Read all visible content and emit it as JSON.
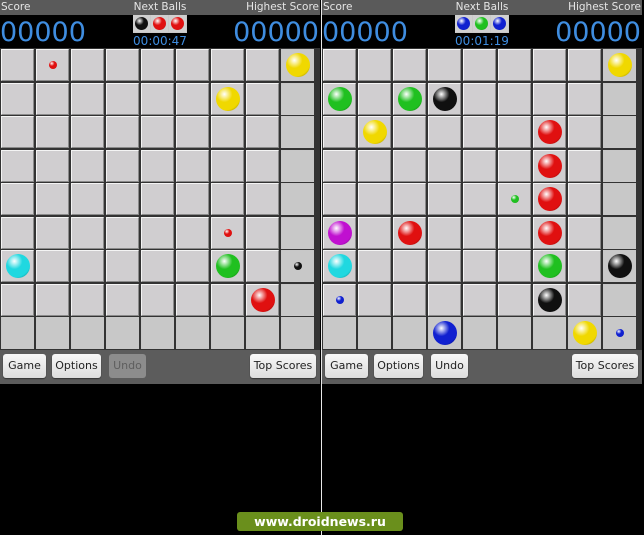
{
  "colors": {
    "red": "#e01010",
    "yellow": "#f0d800",
    "green": "#20c020",
    "black": "#101010",
    "cyan": "#20d8e0",
    "blue": "#1020d0",
    "magenta": "#c010d0",
    "score_text": "#3f8de0"
  },
  "screens": [
    {
      "header": {
        "score_label": "Score",
        "next_label": "Next Balls",
        "highest_label": "Highest Score"
      },
      "score": "00000",
      "highest_score": "00000",
      "next_balls": [
        "black",
        "red",
        "red"
      ],
      "timer": "00:00:47",
      "board": {
        "rows": 9,
        "cols": 9,
        "balls": [
          {
            "row": 0,
            "col": 1,
            "color": "red",
            "size": "small"
          },
          {
            "row": 0,
            "col": 8,
            "color": "yellow",
            "size": "big"
          },
          {
            "row": 1,
            "col": 6,
            "color": "yellow",
            "size": "big"
          },
          {
            "row": 5,
            "col": 6,
            "color": "red",
            "size": "small"
          },
          {
            "row": 6,
            "col": 0,
            "color": "cyan",
            "size": "big"
          },
          {
            "row": 6,
            "col": 6,
            "color": "green",
            "size": "big"
          },
          {
            "row": 6,
            "col": 8,
            "color": "black",
            "size": "small"
          },
          {
            "row": 7,
            "col": 7,
            "color": "red",
            "size": "big"
          }
        ]
      },
      "buttons": {
        "game": "Game",
        "options": "Options",
        "undo": "Undo",
        "undo_enabled": false,
        "top_scores": "Top Scores"
      }
    },
    {
      "header": {
        "score_label": "Score",
        "next_label": "Next Balls",
        "highest_label": "Highest Score"
      },
      "score": "00000",
      "highest_score": "00000",
      "next_balls": [
        "blue",
        "green",
        "blue"
      ],
      "timer": "00:01:19",
      "board": {
        "rows": 9,
        "cols": 9,
        "balls": [
          {
            "row": 0,
            "col": 8,
            "color": "yellow",
            "size": "big"
          },
          {
            "row": 1,
            "col": 0,
            "color": "green",
            "size": "big"
          },
          {
            "row": 1,
            "col": 2,
            "color": "green",
            "size": "big"
          },
          {
            "row": 1,
            "col": 3,
            "color": "black",
            "size": "big"
          },
          {
            "row": 2,
            "col": 1,
            "color": "yellow",
            "size": "big"
          },
          {
            "row": 2,
            "col": 6,
            "color": "red",
            "size": "big"
          },
          {
            "row": 3,
            "col": 6,
            "color": "red",
            "size": "big"
          },
          {
            "row": 4,
            "col": 5,
            "color": "green",
            "size": "small"
          },
          {
            "row": 4,
            "col": 6,
            "color": "red",
            "size": "big"
          },
          {
            "row": 5,
            "col": 0,
            "color": "magenta",
            "size": "big"
          },
          {
            "row": 5,
            "col": 2,
            "color": "red",
            "size": "big"
          },
          {
            "row": 5,
            "col": 6,
            "color": "red",
            "size": "big"
          },
          {
            "row": 6,
            "col": 0,
            "color": "cyan",
            "size": "big"
          },
          {
            "row": 6,
            "col": 6,
            "color": "green",
            "size": "big"
          },
          {
            "row": 6,
            "col": 8,
            "color": "black",
            "size": "big"
          },
          {
            "row": 7,
            "col": 0,
            "color": "blue",
            "size": "small"
          },
          {
            "row": 7,
            "col": 6,
            "color": "black",
            "size": "big"
          },
          {
            "row": 8,
            "col": 3,
            "color": "blue",
            "size": "big"
          },
          {
            "row": 8,
            "col": 7,
            "color": "yellow",
            "size": "big"
          },
          {
            "row": 8,
            "col": 8,
            "color": "blue",
            "size": "small"
          }
        ]
      },
      "buttons": {
        "game": "Game",
        "options": "Options",
        "undo": "Undo",
        "undo_enabled": true,
        "top_scores": "Top Scores"
      }
    }
  ],
  "watermark": "www.droidnews.ru"
}
